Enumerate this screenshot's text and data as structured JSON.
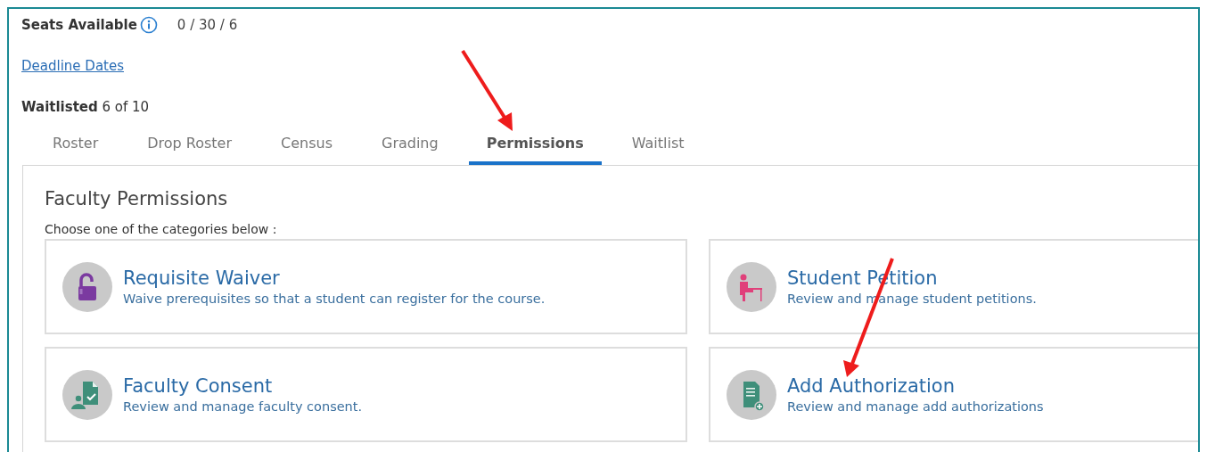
{
  "seats": {
    "label": "Seats Available",
    "value": "0 / 30 / 6"
  },
  "deadline_link": "Deadline Dates",
  "waitlisted": {
    "label": "Waitlisted",
    "value": "6 of 10"
  },
  "tabs": [
    {
      "label": "Roster",
      "selected": false
    },
    {
      "label": "Drop Roster",
      "selected": false
    },
    {
      "label": "Census",
      "selected": false
    },
    {
      "label": "Grading",
      "selected": false
    },
    {
      "label": "Permissions",
      "selected": true
    },
    {
      "label": "Waitlist",
      "selected": false
    }
  ],
  "panel": {
    "title": "Faculty Permissions",
    "instruction": "Choose one of the categories below :",
    "cards": [
      {
        "kind": "lock",
        "title": "Requisite Waiver",
        "description": "Waive prerequisites so that a student can register for the course."
      },
      {
        "kind": "desk",
        "title": "Student Petition",
        "description": "Review and manage student petitions."
      },
      {
        "kind": "consent",
        "title": "Faculty Consent",
        "description": "Review and manage faculty consent."
      },
      {
        "kind": "document",
        "title": "Add Authorization",
        "description": "Review and manage add authorizations"
      }
    ]
  }
}
